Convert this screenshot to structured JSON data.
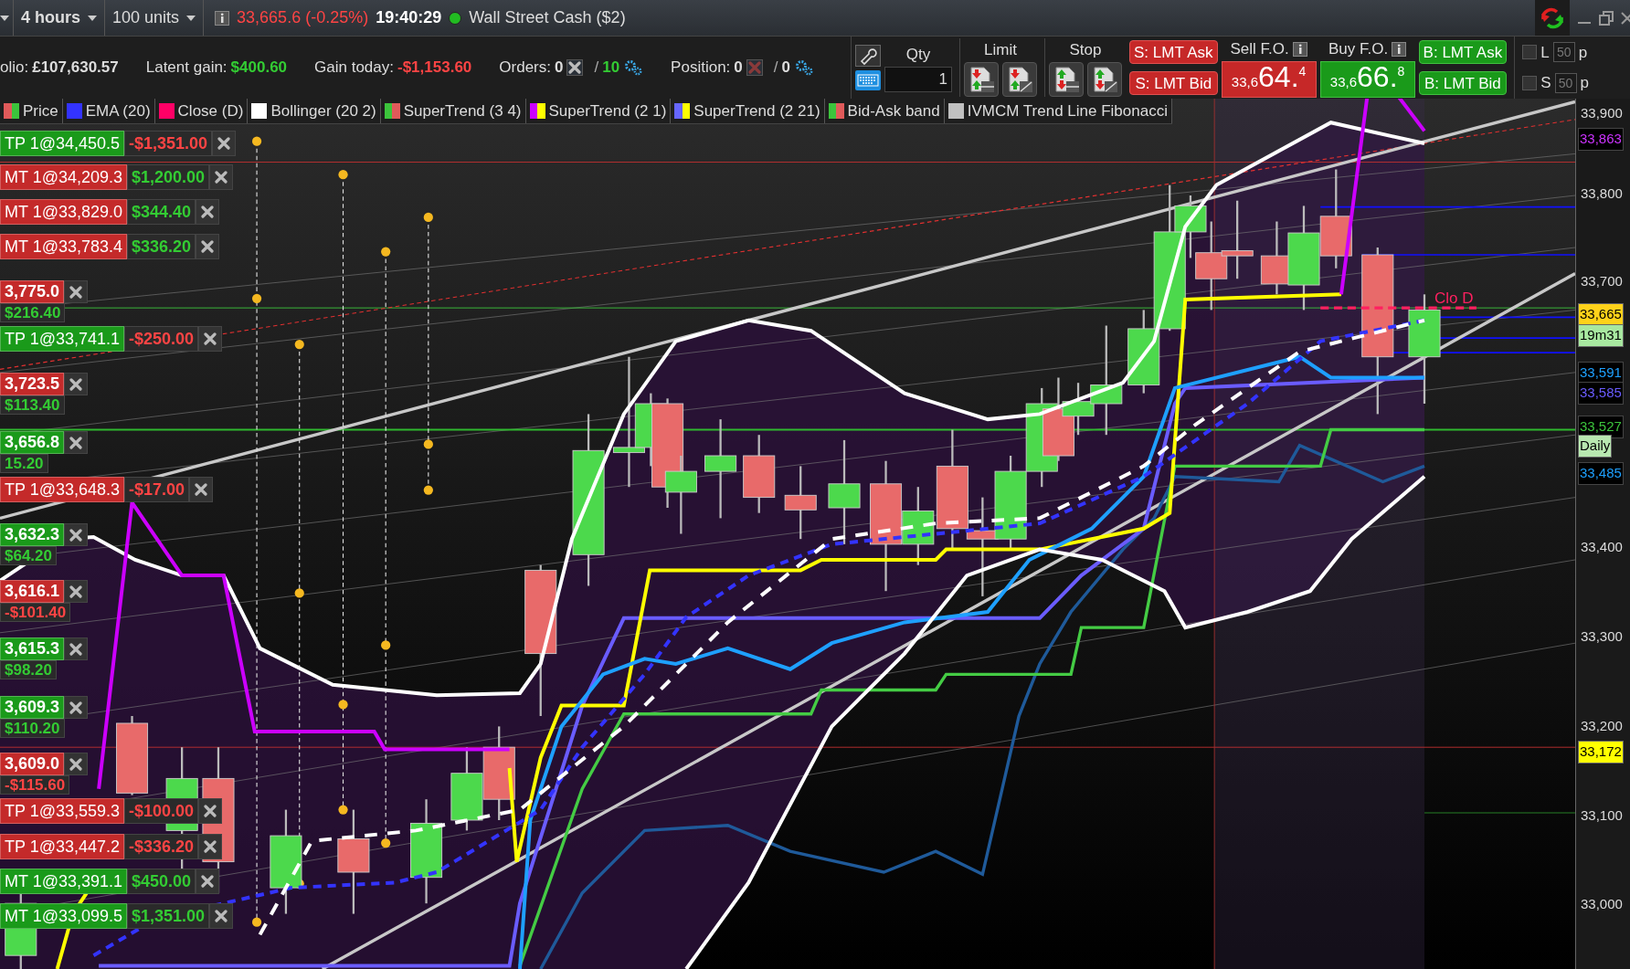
{
  "toolbar": {
    "timeframe": "4 hours",
    "units": "100 units",
    "price_change": "33,665.6 (-0.25%)",
    "time": "19:40:29",
    "market_open": true,
    "instrument": "Wall Street Cash ($2)"
  },
  "account": {
    "portfolio_label": "olio:",
    "portfolio_value": "£107,630.57",
    "latent_label": "Latent gain:",
    "latent_value": "$400.60",
    "today_label": "Gain today:",
    "today_value": "-$1,153.60"
  },
  "counters": [
    {
      "label": "Orders:",
      "open": "0",
      "separator": "/",
      "limit": "10",
      "kind": "orders"
    },
    {
      "label": "Position:",
      "open": "0",
      "separator": "/",
      "limit": "0",
      "kind": "position"
    }
  ],
  "ticket": {
    "qty_label": "Qty",
    "qty": "1",
    "limit_label": "Limit",
    "stop_label": "Stop",
    "sell_ask": "S: LMT Ask",
    "sell_bid": "S: LMT Bid",
    "sell_label": "Sell F.O.",
    "sell_prefix": "33,6",
    "sell_big": "64.",
    "sell_sup": "4",
    "buy_label": "Buy F.O.",
    "buy_prefix": "33,6",
    "buy_big": "66.",
    "buy_sup": "8",
    "buy_ask": "B: LMT Ask",
    "buy_bid": "B: LMT Bid"
  },
  "side_options": [
    {
      "label": "L",
      "value": "50",
      "unit": "p",
      "checked": false
    },
    {
      "label": "S",
      "value": "50",
      "unit": "p",
      "checked": false
    }
  ],
  "legend": [
    {
      "label": "Price",
      "swatch": [
        {
          "color": "#e05a5a"
        },
        {
          "color": "#3cc43c"
        }
      ]
    },
    {
      "label": "EMA (20)",
      "swatch": [
        {
          "color": "#3333ff"
        }
      ]
    },
    {
      "label": "Close (D)",
      "swatch": [
        {
          "color": "#ff0066"
        }
      ]
    },
    {
      "label": "Bollinger (20 2)",
      "swatch": [
        {
          "color": "#ffffff"
        }
      ]
    },
    {
      "label": "SuperTrend (3 4)",
      "swatch": [
        {
          "color": "#3cc43c"
        },
        {
          "color": "#e05a5a"
        }
      ]
    },
    {
      "label": "SuperTrend (2 1)",
      "swatch": [
        {
          "color": "#cc00ff"
        },
        {
          "color": "#ffff00"
        }
      ]
    },
    {
      "label": "SuperTrend (2 21)",
      "swatch": [
        {
          "color": "#6666ff"
        },
        {
          "color": "#ffff00"
        }
      ]
    },
    {
      "label": "Bid-Ask band",
      "swatch": [
        {
          "color": "#3cc43c"
        },
        {
          "color": "#e05a5a"
        }
      ]
    },
    {
      "label": "IVMCM Trend Line Fibonacci",
      "swatch": [
        {
          "color": "#c0c0c0"
        }
      ]
    }
  ],
  "chart": {
    "close_label": "Clo D",
    "orders": [
      {
        "kind": "inline",
        "label": {
          "text": "TP 1@34,450.5",
          "color": "#1a9a1a"
        },
        "pnl": {
          "text": "-$1,351.00",
          "color": "#ff4444"
        }
      },
      {
        "kind": "inline",
        "label": {
          "text": "MT 1@34,209.3",
          "color": "#c42a2a"
        },
        "pnl": {
          "text": "$1,200.00",
          "color": "#33cc33"
        }
      },
      {
        "kind": "inline",
        "label": {
          "text": "MT 1@33,829.0",
          "color": "#c42a2a"
        },
        "pnl": {
          "text": "$344.40",
          "color": "#33cc33"
        }
      },
      {
        "kind": "inline",
        "label": {
          "text": "MT 1@33,783.4",
          "color": "#c42a2a"
        },
        "pnl": {
          "text": "$336.20",
          "color": "#33cc33"
        }
      },
      {
        "kind": "stacked",
        "label": {
          "text": "3,775.0",
          "color": "#c42a2a"
        },
        "pnl": {
          "text": "$216.40",
          "color": "#33cc33"
        }
      },
      {
        "kind": "inline",
        "label": {
          "text": "TP 1@33,741.1",
          "color": "#1a9a1a"
        },
        "pnl": {
          "text": "-$250.00",
          "color": "#ff4444"
        }
      },
      {
        "kind": "stacked",
        "label": {
          "text": "3,723.5",
          "color": "#c42a2a"
        },
        "pnl": {
          "text": "$113.40",
          "color": "#33cc33"
        }
      },
      {
        "kind": "stacked",
        "label": {
          "text": "3,656.8",
          "color": "#1a9a1a"
        },
        "pnl": {
          "text": "15.20",
          "color": "#33cc33"
        }
      },
      {
        "kind": "inline",
        "label": {
          "text": "TP 1@33,648.3",
          "color": "#c42a2a"
        },
        "pnl": {
          "text": "-$17.00",
          "color": "#ff4444"
        }
      },
      {
        "kind": "stacked",
        "label": {
          "text": "3,632.3",
          "color": "#1a9a1a"
        },
        "pnl": {
          "text": "$64.20",
          "color": "#33cc33"
        }
      },
      {
        "kind": "stacked",
        "label": {
          "text": "3,616.1",
          "color": "#c42a2a"
        },
        "pnl": {
          "text": "-$101.40",
          "color": "#ff4444"
        }
      },
      {
        "kind": "stacked",
        "label": {
          "text": "3,615.3",
          "color": "#1a9a1a"
        },
        "pnl": {
          "text": "$98.20",
          "color": "#33cc33"
        }
      },
      {
        "kind": "stacked",
        "label": {
          "text": "3,609.3",
          "color": "#1a9a1a"
        },
        "pnl": {
          "text": "$110.20",
          "color": "#33cc33"
        }
      },
      {
        "kind": "stacked",
        "label": {
          "text": "3,609.0",
          "color": "#c42a2a"
        },
        "pnl": {
          "text": "-$115.60",
          "color": "#ff4444"
        }
      },
      {
        "kind": "inline",
        "label": {
          "text": "TP 1@33,559.3",
          "color": "#c42a2a"
        },
        "pnl": {
          "text": "-$100.00",
          "color": "#ff4444"
        }
      },
      {
        "kind": "inline",
        "label": {
          "text": "TP 1@33,447.2",
          "color": "#c42a2a"
        },
        "pnl": {
          "text": "-$336.20",
          "color": "#ff4444"
        }
      },
      {
        "kind": "inline",
        "label": {
          "text": "MT 1@33,391.1",
          "color": "#1a9a1a"
        },
        "pnl": {
          "text": "$450.00",
          "color": "#33cc33"
        }
      },
      {
        "kind": "inline",
        "label": {
          "text": "MT 1@33,099.5",
          "color": "#1a9a1a"
        },
        "pnl": {
          "text": "$1,351.00",
          "color": "#33cc33"
        }
      }
    ],
    "axis_labels": [
      {
        "text": "33,900",
        "kind": "tick"
      },
      {
        "text": "33,863",
        "kind": "tag",
        "color": "#cc33ff"
      },
      {
        "text": "33,800",
        "kind": "tick"
      },
      {
        "text": "33,700",
        "kind": "tick"
      },
      {
        "text": "33,665",
        "kind": "highlight",
        "color": "#ffd21a"
      },
      {
        "text": "19m31",
        "kind": "highlight",
        "color": "#a8e8a0"
      },
      {
        "text": "33,591",
        "kind": "tag",
        "color": "#1ea0ff"
      },
      {
        "text": "33,585",
        "kind": "tag",
        "color": "#6a5cff"
      },
      {
        "text": "33,527",
        "kind": "tag",
        "color": "#3cc43c"
      },
      {
        "text": "Daily",
        "kind": "highlight",
        "color": "#b8e8b0"
      },
      {
        "text": "33,485",
        "kind": "tag",
        "color": "#1ea0ff"
      },
      {
        "text": "33,400",
        "kind": "tick"
      },
      {
        "text": "33,300",
        "kind": "tick"
      },
      {
        "text": "33,200",
        "kind": "tick"
      },
      {
        "text": "33,172",
        "kind": "highlight",
        "color": "#ffff00"
      },
      {
        "text": "33,100",
        "kind": "tick"
      },
      {
        "text": "33,000",
        "kind": "tick"
      }
    ]
  }
}
